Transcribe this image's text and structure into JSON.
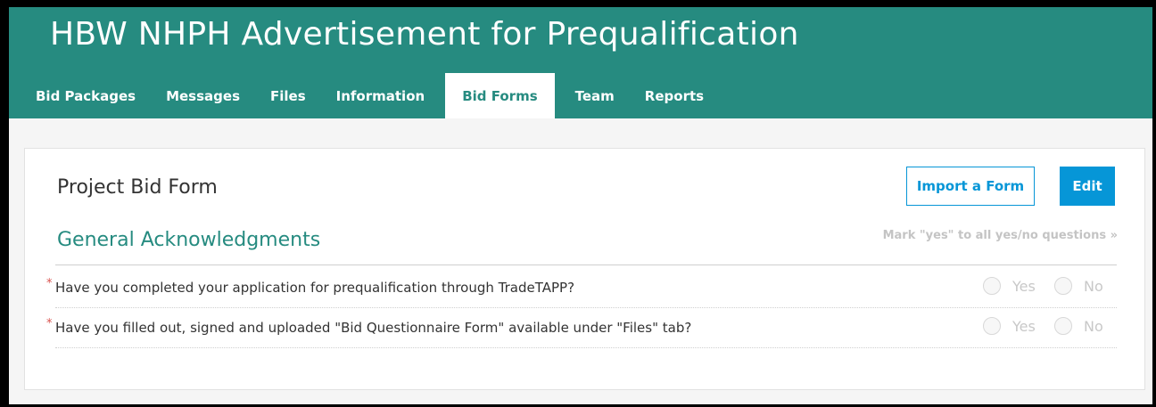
{
  "header": {
    "title": "HBW NHPH Advertisement for Prequalification",
    "tabs": [
      {
        "label": "Bid Packages",
        "active": false
      },
      {
        "label": "Messages",
        "active": false
      },
      {
        "label": "Files",
        "active": false
      },
      {
        "label": "Information",
        "active": false
      },
      {
        "label": "Bid Forms",
        "active": true
      },
      {
        "label": "Team",
        "active": false
      },
      {
        "label": "Reports",
        "active": false
      }
    ]
  },
  "form": {
    "title": "Project Bid Form",
    "import_label": "Import a Form",
    "edit_label": "Edit",
    "section_title": "General Acknowledgments",
    "mark_all_label": "Mark \"yes\" to all yes/no questions »",
    "required_marker": "*",
    "yes_label": "Yes",
    "no_label": "No",
    "questions": [
      {
        "text": "Have you completed your application for prequalification through TradeTAPP?"
      },
      {
        "text": "Have you filled out, signed and uploaded \"Bid Questionnaire Form\" available under \"Files\" tab?"
      }
    ]
  },
  "colors": {
    "header_bg": "#268b80",
    "accent_blue": "#0696d7",
    "section_title": "#268b80",
    "required": "#d9534f"
  }
}
